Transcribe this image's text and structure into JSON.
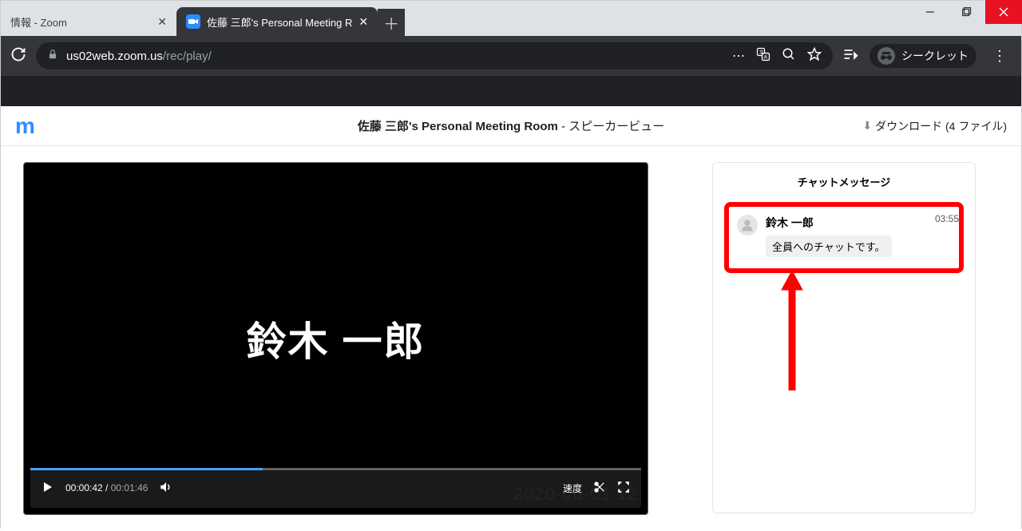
{
  "browser": {
    "tabs": [
      {
        "title": "情報 - Zoom",
        "active": false
      },
      {
        "title": "佐藤 三郎's Personal Meeting R",
        "active": true
      }
    ],
    "url_host": "us02web.zoom.us",
    "url_path": "/rec/play/",
    "incognito_label": "シークレット"
  },
  "page": {
    "title_bold": "佐藤 三郎's Personal Meeting Room",
    "title_suffix": " - スピーカービュー",
    "download_label": "ダウンロード (4 ファイル)"
  },
  "player": {
    "speaker": "鈴木 一郎",
    "current_time": "00:00:42",
    "duration": "00:01:46",
    "watermark": "2020-06-01 12",
    "speed_label": "速度"
  },
  "chat": {
    "header": "チャットメッセージ",
    "user": "鈴木 一郎",
    "message": "全員へのチャットです。",
    "time": "03:55"
  }
}
